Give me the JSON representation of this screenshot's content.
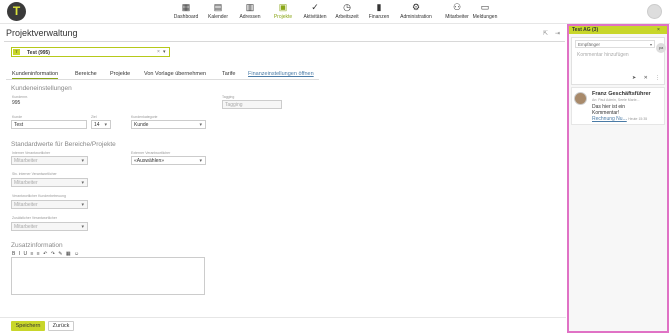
{
  "nav": {
    "logo": "T",
    "items": [
      {
        "label": "Dashboard",
        "icon": "▦"
      },
      {
        "label": "Kalender",
        "icon": "▤"
      },
      {
        "label": "Adressen",
        "icon": "▥"
      },
      {
        "label": "Projekte",
        "icon": "▣"
      },
      {
        "label": "Aktivitäten",
        "icon": "✓"
      },
      {
        "label": "Arbeitszeit",
        "icon": "◷"
      },
      {
        "label": "Finanzen",
        "icon": "▮"
      },
      {
        "label": "Administration",
        "icon": "⚙"
      },
      {
        "label": "Mitarbeiter",
        "icon": "⚇"
      },
      {
        "label": "Meldungen",
        "icon": "▭"
      }
    ],
    "accent": "#8aa617"
  },
  "page": {
    "title": "Projektverwaltung",
    "project_select": {
      "tag": "T",
      "value": "Test (995)",
      "clear": "×",
      "caret": "▾"
    }
  },
  "tabs": [
    {
      "label": "Kundeninformation"
    },
    {
      "label": "Bereiche"
    },
    {
      "label": "Projekte"
    },
    {
      "label": "Von Vorlage übernehmen"
    },
    {
      "label": "Tarife"
    },
    {
      "label": "Finanzeinstellungen öffnen"
    }
  ],
  "kunden": {
    "section": "Kundeneinstellungen",
    "kundennr_label": "Kundennr.",
    "kundennr_value": "995",
    "tagging_label": "Tagging",
    "tagging_placeholder": "Tagging",
    "kunde_label": "Kunde",
    "kunde_value": "Test",
    "ziel_label": "Ziel",
    "ziel_value": "14",
    "kategorie_label": "Kundenkategorie",
    "kategorie_value": "Kunde"
  },
  "standard": {
    "section": "Standardwerte für Bereiche/Projekte",
    "intern_label": "Interner Verantwortlicher",
    "intern_value": "Mitarbeiter",
    "extern_label": "Externer Verantwortlicher",
    "extern_value": "«Auswählen»",
    "stv_intern_label": "Stv. interner Verantwortlicher",
    "stv_intern_value": "Mitarbeiter",
    "kundenbetr_label": "Verantwortlicher Kundenbetreuung",
    "kundenbetr_value": "Mitarbeiter",
    "zusatz_label": "Zusätzlicher Verantwortlicher",
    "zusatz_value": "Mitarbeiter",
    "caret": "▾"
  },
  "zusatz": {
    "section": "Zusatzinformation",
    "toolbar": "B I U ≡ ≡ ↶ ↷ ✎ ▦ ☺"
  },
  "footer": {
    "save": "Speichern",
    "back": "Zurück"
  },
  "rpanel": {
    "title": "Test AG (3)",
    "close": "×",
    "recipients_placeholder": "Empfänger",
    "recipients_caret": "▾",
    "comment_placeholder": "Kommentar hinzufügen",
    "avatar_initials": "pa",
    "actions": "➤ ✕ ⋮",
    "card": {
      "author": "Franz Geschäftsführer",
      "meta": "An: Paul Admin, Seele Marie...",
      "body1": "Das hier ist ein",
      "body2": "Kommentar!",
      "link": "Rechnung Nu...",
      "time": "- Heute 15:35"
    },
    "border_color": "#e072c5"
  }
}
